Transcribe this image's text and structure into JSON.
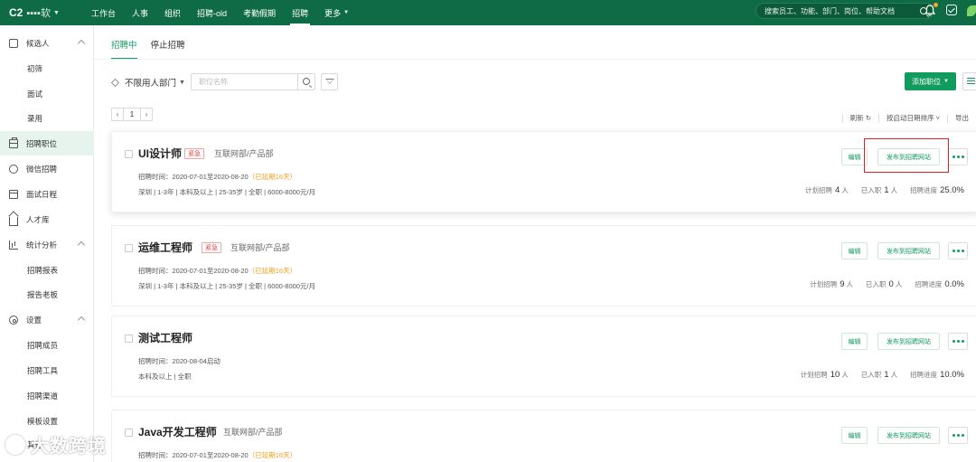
{
  "topbar": {
    "logo_mark": "C2",
    "company": "▪▪▪▪软",
    "nav": [
      {
        "label": "工作台"
      },
      {
        "label": "人事"
      },
      {
        "label": "组织"
      },
      {
        "label": "招聘-old"
      },
      {
        "label": "考勤假期"
      },
      {
        "label": "招聘"
      },
      {
        "label": "更多"
      }
    ],
    "active_nav": "招聘",
    "search_placeholder": "搜索员工、功能、部门、岗位、帮助文档"
  },
  "sidebar": {
    "items": [
      {
        "label": "候选人"
      },
      {
        "label": "初筛"
      },
      {
        "label": "面试"
      },
      {
        "label": "录用"
      },
      {
        "label": "招聘职位"
      },
      {
        "label": "微信招聘"
      },
      {
        "label": "面试日程"
      },
      {
        "label": "人才库"
      },
      {
        "label": "统计分析"
      },
      {
        "label": "招聘报表"
      },
      {
        "label": "报告老板"
      },
      {
        "label": "设置"
      },
      {
        "label": "招聘成员"
      },
      {
        "label": "招聘工具"
      },
      {
        "label": "招聘渠道"
      },
      {
        "label": "模板设置"
      },
      {
        "label": "其他"
      }
    ],
    "active": "招聘职位"
  },
  "tabs": [
    {
      "label": "招聘中"
    },
    {
      "label": "停止招聘"
    }
  ],
  "filters": {
    "department": "不限用人部门",
    "position_placeholder": "职位名称",
    "add_position": "添加职位"
  },
  "pager": {
    "prev": "‹",
    "current": "1",
    "next": "›"
  },
  "toolbar": {
    "refresh": "刷新 ↻",
    "sort": "按启动日期排序 ˅",
    "export": "导出"
  },
  "labels": {
    "urgent": "紧急",
    "edit": "编辑",
    "publish": "发布到招聘网站",
    "planned": "计划招聘",
    "hired": "已入职",
    "progress": "招聘进度",
    "person_unit": "人"
  },
  "positions": [
    {
      "title": "UI设计师",
      "urgent": true,
      "department": "互联网部/产品部",
      "time": "招聘时间：2020-07-01至2020-08-20",
      "extended": "（已延期16天）",
      "requirements": "深圳 | 1-3年 | 本科及以上 | 25-35岁 | 全职 | 6000-8000元/月",
      "planned": "4",
      "hired": "1",
      "progress": "25.0%"
    },
    {
      "title": "运维工程师",
      "urgent": true,
      "department": "互联网部/产品部",
      "time": "招聘时间：2020-07-01至2020-08-20",
      "extended": "（已延期16天）",
      "requirements": "深圳 | 1-3年 | 本科及以上 | 25-35岁 | 全职 | 6000-8000元/月",
      "planned": "9",
      "hired": "0",
      "progress": "0.0%"
    },
    {
      "title": "测试工程师",
      "urgent": false,
      "department": "",
      "time": "招聘时间：2020-08-04启动",
      "extended": "",
      "requirements": "本科及以上 | 全职",
      "planned": "10",
      "hired": "1",
      "progress": "10.0%"
    },
    {
      "title": "Java开发工程师",
      "urgent": false,
      "department": "互联网部/产品部",
      "time": "招聘时间：2020-07-01至2020-08-20",
      "extended": "（已延期16天）",
      "requirements": "",
      "planned": "",
      "hired": "",
      "progress": ""
    }
  ],
  "watermark": "大数跨境",
  "colors": {
    "brand": "#0f6b45",
    "accent": "#129b5f",
    "highlight": "#e02020",
    "extended": "#f0a020",
    "urgent": "#e24a4a"
  },
  "icons": {
    "bell": "bell-icon",
    "check": "check-square-icon",
    "search": "search-icon",
    "filter": "filter-icon",
    "menu": "menu-icon"
  }
}
